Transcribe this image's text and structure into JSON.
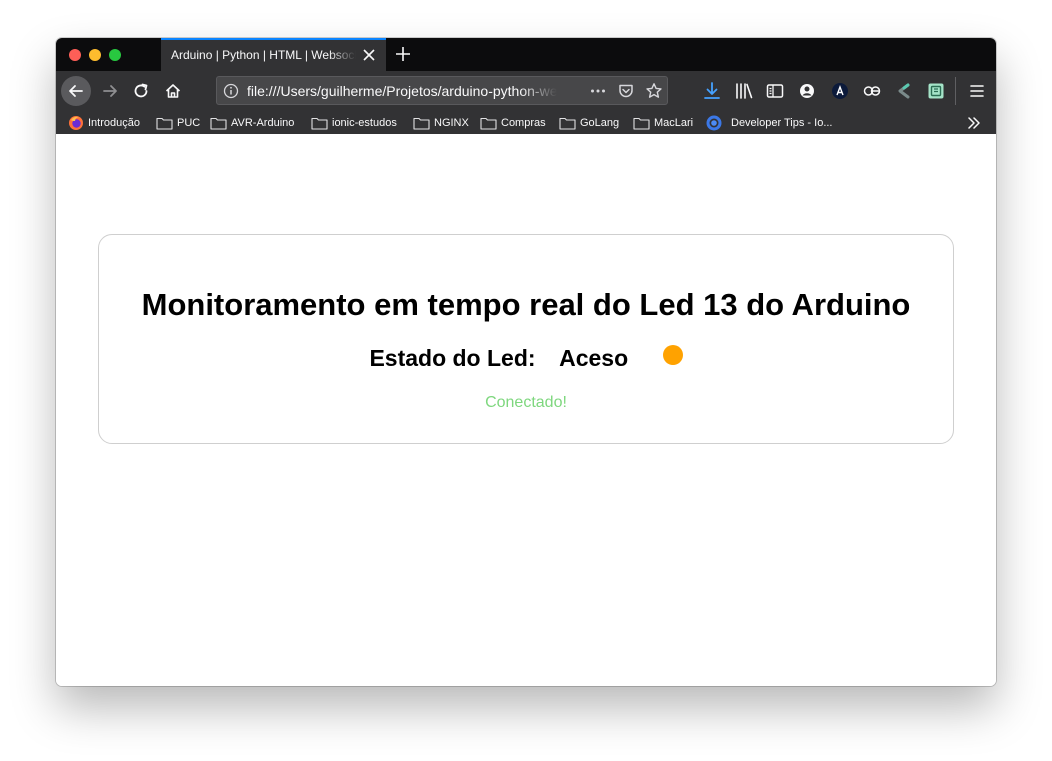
{
  "browser": {
    "tab_title": "Arduino | Python | HTML | Websocket",
    "url": "file:///Users/guilherme/Projetos/arduino-python-websocket/index.html",
    "accent_color": "#0a84ff",
    "toolbar_icons": [
      "back-arrow-icon",
      "forward-arrow-icon",
      "reload-icon",
      "home-icon",
      "info-icon",
      "page-actions-icon",
      "pocket-icon",
      "bookmark-star-icon",
      "download-icon",
      "library-icon",
      "sidebar-icon",
      "account-icon",
      "extension-a-icon",
      "extension-ae-icon",
      "extension-c-icon",
      "extension-green-icon",
      "hamburger-menu-icon"
    ]
  },
  "bookmarks": {
    "items": [
      {
        "label": "Introdução",
        "icon": "firefox-icon"
      },
      {
        "label": "PUC",
        "icon": "folder-icon"
      },
      {
        "label": "AVR-Arduino",
        "icon": "folder-icon"
      },
      {
        "label": "ionic-estudos",
        "icon": "folder-icon"
      },
      {
        "label": "NGINX",
        "icon": "folder-icon"
      },
      {
        "label": "Compras",
        "icon": "folder-icon"
      },
      {
        "label": "GoLang",
        "icon": "folder-icon"
      },
      {
        "label": "MacLari",
        "icon": "folder-icon"
      },
      {
        "label": "Developer Tips - Io...",
        "icon": "chrome-status-icon"
      }
    ]
  },
  "page": {
    "title": "Monitoramento em tempo real do Led 13 do Arduino",
    "led_label": "Estado do Led:",
    "led_state": "Aceso",
    "led_color": "#ffa200",
    "connection_status": "Conectado!",
    "connection_color": "#7ed77e"
  }
}
